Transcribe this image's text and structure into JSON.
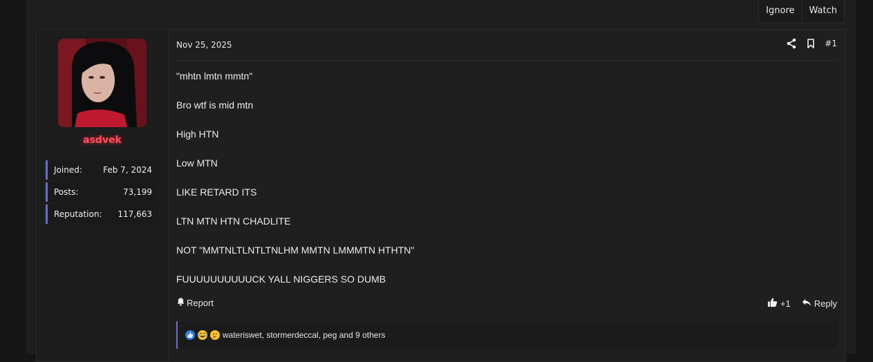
{
  "thread_actions": {
    "ignore": "Ignore",
    "watch": "Watch"
  },
  "user": {
    "name": "asdvek",
    "name_color": "#ff4d5e",
    "stats": [
      {
        "label": "Joined:",
        "value": "Feb 7, 2024"
      },
      {
        "label": "Posts:",
        "value": "73,199"
      },
      {
        "label": "Reputation:",
        "value": "117,663"
      }
    ]
  },
  "post": {
    "date": "Nov 25, 2025",
    "number": "#1",
    "icons": [
      "share-icon",
      "bookmark-icon"
    ],
    "lines": [
      "\"mhtn lmtn mmtn\"",
      "Bro wtf is mid mtn",
      "High HTN",
      "Low MTN",
      "LIKE RETARD ITS",
      "LTN MTN HTN CHADLITE",
      "NOT \"MMTNLTLNTLTNLHM MMTN LMMMTN HTHTN\"",
      "FUUUUUUUUUUCK YALL NIGGERS SO DUMB"
    ],
    "report_label": "Report",
    "like_count": "+1",
    "reply_label": "Reply",
    "reactions_text": "wateriswet, stormerdeccal, peg and 9 others"
  },
  "colors": {
    "accent": "#6d6ec2",
    "background": "#1e1e1e"
  }
}
